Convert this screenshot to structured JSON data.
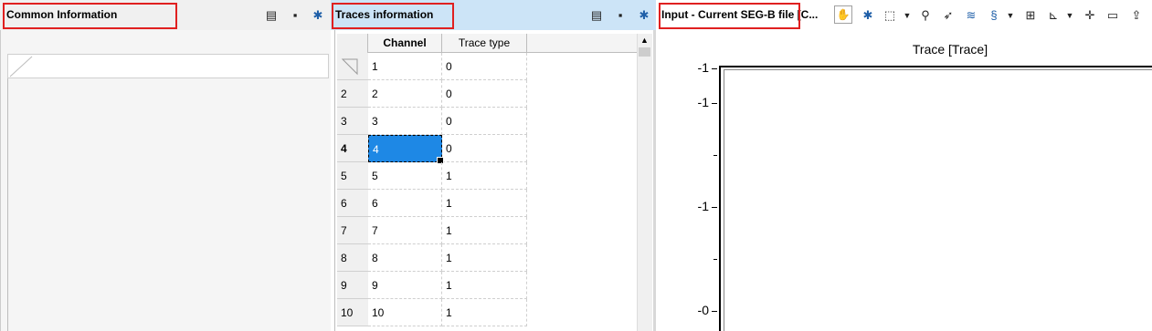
{
  "left_panel": {
    "title": "Common Information"
  },
  "middle_panel": {
    "title": "Traces information",
    "columns": [
      "Channel",
      "Trace type"
    ],
    "rows": [
      {
        "num": "",
        "channel": "1",
        "trace_type": "0"
      },
      {
        "num": "2",
        "channel": "2",
        "trace_type": "0"
      },
      {
        "num": "3",
        "channel": "3",
        "trace_type": "0"
      },
      {
        "num": "4",
        "channel": "4",
        "trace_type": "0"
      },
      {
        "num": "5",
        "channel": "5",
        "trace_type": "1"
      },
      {
        "num": "6",
        "channel": "6",
        "trace_type": "1"
      },
      {
        "num": "7",
        "channel": "7",
        "trace_type": "1"
      },
      {
        "num": "8",
        "channel": "8",
        "trace_type": "1"
      },
      {
        "num": "9",
        "channel": "9",
        "trace_type": "1"
      },
      {
        "num": "10",
        "channel": "10",
        "trace_type": "1"
      }
    ],
    "selected_row": 4
  },
  "right_panel": {
    "title": "Input - Current SEG-B file [C...",
    "chart_title": "Trace [Trace]",
    "y_ticks": [
      "-1",
      "-1",
      "-1",
      "-0"
    ]
  },
  "icons": {
    "table_icon": "table-icon",
    "save_icon": "save-icon",
    "settings_icon": "gear-icon",
    "hand": "hand-icon",
    "zoom": "magnifier-icon"
  },
  "colors": {
    "selection": "#1e88e5",
    "highlight_header": "#cce4f7",
    "annotation_box": "#e02020"
  }
}
